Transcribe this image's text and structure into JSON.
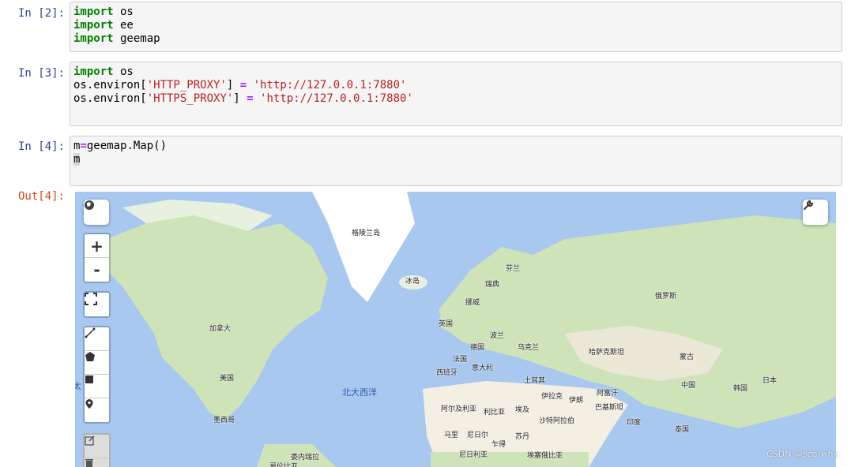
{
  "cells": [
    {
      "prompt": "In [2]:",
      "lines": [
        {
          "kw": "import",
          "rest": " os"
        },
        {
          "kw": "import",
          "rest": " ee"
        },
        {
          "kw": "import",
          "rest": " geemap"
        }
      ]
    },
    {
      "prompt": "In [3]:",
      "line1": {
        "kw": "import",
        "rest": " os"
      },
      "line2": {
        "pre": "os.environ[",
        "key": "'HTTP_PROXY'",
        "mid": "] ",
        "op": "=",
        "sp": " ",
        "val": "'http://127.0.0.1:7880'"
      },
      "line3": {
        "pre": "os.environ[",
        "key": "'HTTPS_PROXY'",
        "mid": "] ",
        "op": "=",
        "sp": " ",
        "val": "'http://127.0.0.1:7880'"
      }
    },
    {
      "prompt": "In [4]:",
      "line1": {
        "var": "m",
        "op": "=",
        "rest": "geemap.Map()"
      },
      "line2": {
        "var": "m"
      }
    }
  ],
  "output": {
    "prompt": "Out[4]:"
  },
  "map": {
    "labels": {
      "greenland": "格陵兰岛",
      "iceland": "冰岛",
      "finland": "芬兰",
      "sweden": "瑞典",
      "norway": "挪威",
      "russia": "俄罗斯",
      "uk": "英国",
      "poland": "波兰",
      "germany": "德国",
      "ukraine": "乌克兰",
      "france": "法国",
      "kazakhstan": "哈萨克斯坦",
      "mongolia": "蒙古",
      "italy": "意大利",
      "spain": "西班牙",
      "turkey": "土耳其",
      "china": "中国",
      "korea": "韩国",
      "japan": "日本",
      "canada": "加拿大",
      "usa": "美国",
      "mexico": "墨西哥",
      "atlantic": "北大西洋",
      "pacific_fragment": "太",
      "algeria": "阿尔及利亚",
      "libya": "利比亚",
      "egypt": "埃及",
      "iraq": "伊拉克",
      "iran": "伊朗",
      "afghanistan": "阿富汗",
      "pakistan": "巴基斯坦",
      "saudi": "沙特阿拉伯",
      "india": "印度",
      "thailand": "泰国",
      "mali": "马里",
      "niger": "尼日尔",
      "chad": "乍得",
      "sudan": "苏丹",
      "nigeria": "尼日利亚",
      "ethiopia": "埃塞俄比亚",
      "venezuela": "委内瑞拉",
      "colombia": "哥伦比亚"
    },
    "controls": {
      "globe_icon": "globe-icon",
      "zoom_in": "+",
      "zoom_out": "-",
      "wrench_icon": "wrench-icon"
    },
    "colors": {
      "ocean": "#a8c8f0",
      "land": "#cfe3b8",
      "desert": "#f4efe3",
      "ice": "#ffffff"
    }
  },
  "watermark": "CSDN @sco-whx"
}
